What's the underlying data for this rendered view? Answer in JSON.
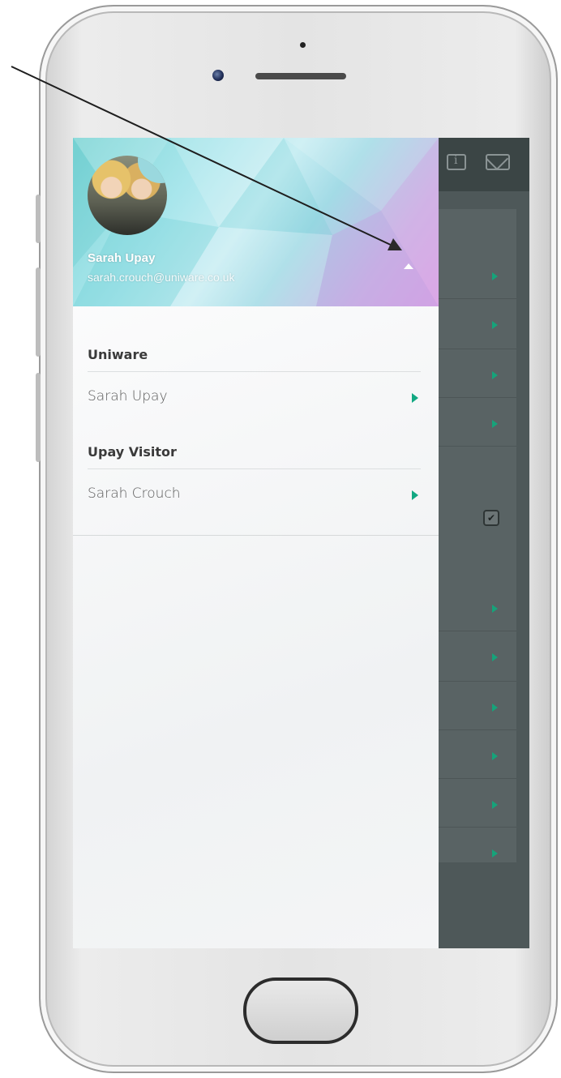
{
  "profile": {
    "name": "Sarah Upay",
    "email": "sarah.crouch@uniware.co.uk"
  },
  "sections": [
    {
      "heading": "Uniware",
      "accounts": [
        {
          "label": "Sarah Upay"
        }
      ]
    },
    {
      "heading": "Upay Visitor",
      "accounts": [
        {
          "label": "Sarah Crouch"
        }
      ]
    }
  ],
  "icons": {
    "profile_toggle": "caret-up-icon",
    "account_arrow": "chevron-right-icon",
    "background_info": "info-icon",
    "background_mail": "mail-icon",
    "background_check": "checkbox-checked-icon"
  },
  "colors": {
    "accent_green": "#12a882",
    "overlay": "#5c6263"
  }
}
